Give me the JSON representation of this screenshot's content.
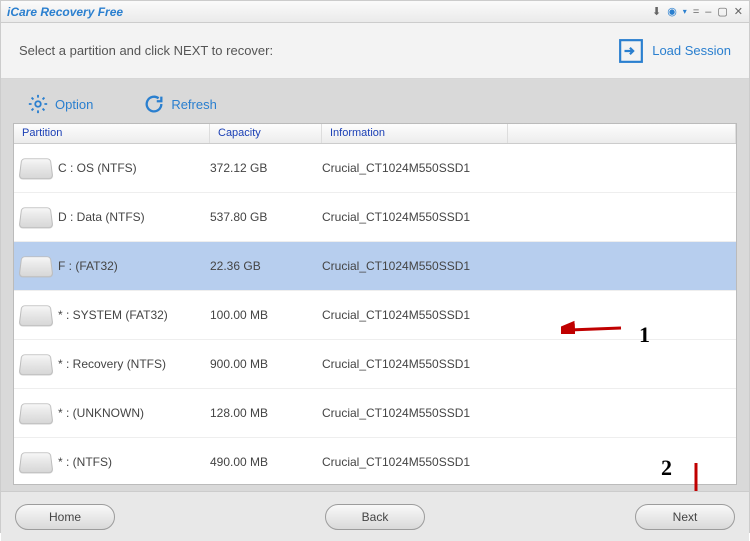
{
  "window": {
    "title": "iCare Recovery Free"
  },
  "header": {
    "instruction": "Select a partition and click NEXT to recover:",
    "load_session": "Load Session"
  },
  "toolbar": {
    "option": "Option",
    "refresh": "Refresh"
  },
  "columns": {
    "partition": "Partition",
    "capacity": "Capacity",
    "information": "Information"
  },
  "partitions": [
    {
      "name": "C : OS  (NTFS)",
      "capacity": "372.12 GB",
      "info": "Crucial_CT1024M550SSD1",
      "selected": false
    },
    {
      "name": "D : Data  (NTFS)",
      "capacity": "537.80 GB",
      "info": "Crucial_CT1024M550SSD1",
      "selected": false
    },
    {
      "name": "F :  (FAT32)",
      "capacity": "22.36 GB",
      "info": "Crucial_CT1024M550SSD1",
      "selected": true
    },
    {
      "name": "* : SYSTEM  (FAT32)",
      "capacity": "100.00 MB",
      "info": "Crucial_CT1024M550SSD1",
      "selected": false
    },
    {
      "name": "* : Recovery  (NTFS)",
      "capacity": "900.00 MB",
      "info": "Crucial_CT1024M550SSD1",
      "selected": false
    },
    {
      "name": "* :  (UNKNOWN)",
      "capacity": "128.00 MB",
      "info": "Crucial_CT1024M550SSD1",
      "selected": false
    },
    {
      "name": "* :  (NTFS)",
      "capacity": "490.00 MB",
      "info": "Crucial_CT1024M550SSD1",
      "selected": false
    }
  ],
  "annotations": {
    "one": "1",
    "two": "2"
  },
  "footer": {
    "home": "Home",
    "back": "Back",
    "next": "Next"
  }
}
